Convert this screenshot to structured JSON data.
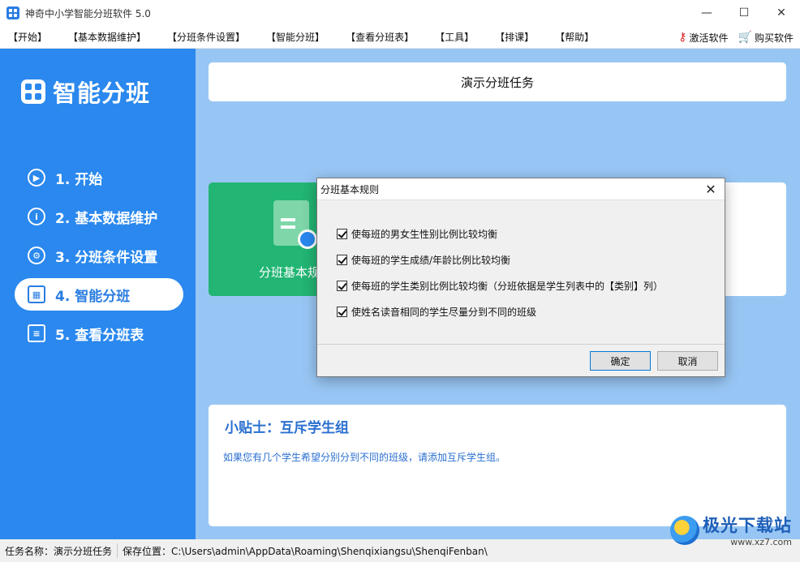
{
  "window": {
    "title": "神奇中小学智能分班软件 5.0",
    "minimize": "—",
    "maximize": "☐",
    "close": "✕"
  },
  "menubar": {
    "items": [
      "【开始】",
      "【基本数据维护】",
      "【分班条件设置】",
      "【智能分班】",
      "【查看分班表】",
      "【工具】",
      "【排课】",
      "【帮助】"
    ],
    "activate": "激活软件",
    "buy": "购买软件"
  },
  "sidebar": {
    "brand": "智能分班",
    "items": [
      {
        "label": "1. 开始",
        "icon": "play-icon"
      },
      {
        "label": "2. 基本数据维护",
        "icon": "info-icon"
      },
      {
        "label": "3. 分班条件设置",
        "icon": "gear-icon"
      },
      {
        "label": "4. 智能分班",
        "icon": "table-icon"
      },
      {
        "label": "5. 查看分班表",
        "icon": "search-list-icon"
      }
    ],
    "active_index": 3
  },
  "main": {
    "task_title": "演示分班任务",
    "card_label": "分班基本规",
    "tip_title": "小贴士：互斥学生组",
    "tip_text": "如果您有几个学生希望分别分到不同的班级，请添加互斥学生组。"
  },
  "dialog": {
    "title": "分班基本规则",
    "options": [
      {
        "label": "使每班的男女生性别比例比较均衡",
        "checked": true
      },
      {
        "label": "使每班的学生成绩/年龄比例比较均衡",
        "checked": true
      },
      {
        "label": "使每班的学生类别比例比较均衡（分班依据是学生列表中的【类别】列）",
        "checked": true
      },
      {
        "label": "使姓名读音相同的学生尽量分到不同的班级",
        "checked": true
      }
    ],
    "ok": "确定",
    "cancel": "取消"
  },
  "statusbar": {
    "task_name": "任务名称：演示分班任务",
    "save_location": "保存位置：C:\\Users\\admin\\AppData\\Roaming\\Shenqixiangsu\\ShenqiFenban\\"
  },
  "watermark": {
    "main": "极光下载站",
    "sub": "www.xz7.com"
  },
  "colors": {
    "sidebar": "#2a88ee",
    "main_bg": "#98c6f4",
    "card_green": "#22b573",
    "tip_text": "#2a6fd0"
  }
}
